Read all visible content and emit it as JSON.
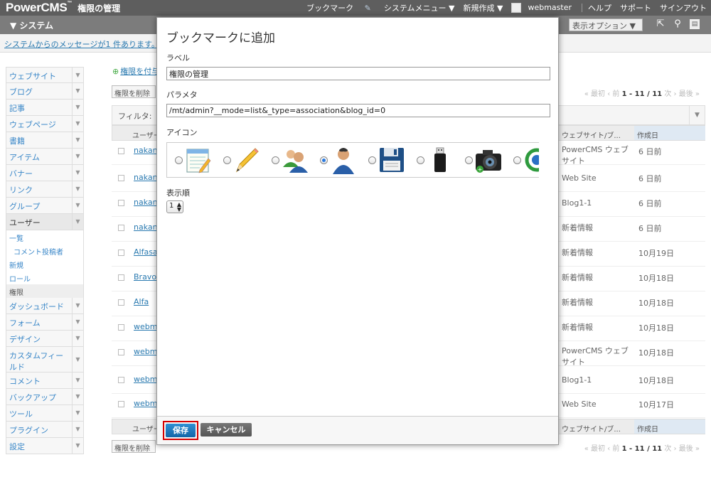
{
  "header": {
    "brand": "PowerCMS",
    "brand_mark": "™",
    "page_title": "権限の管理",
    "bookmark": "ブックマーク",
    "system_menu": "システムメニュー ▼",
    "new_item": "新規作成 ▼",
    "user": "webmaster",
    "help": "ヘルプ",
    "support": "サポート",
    "signout": "サインアウト"
  },
  "subheader": {
    "scope": "▼ システム",
    "display_options": "表示オプション ▼"
  },
  "message_bar": {
    "text": "システムからのメッセージが1 件あります。"
  },
  "sidebar": {
    "items_top": [
      "ウェブサイト",
      "ブログ",
      "記事",
      "ウェブページ",
      "書籍",
      "アイテム",
      "バナー",
      "リンク",
      "グループ"
    ],
    "open_item": "ユーザー",
    "sub_items": [
      {
        "label": "一覧",
        "indent": false
      },
      {
        "label": "コメント投稿者",
        "indent": true
      },
      {
        "label": "新規",
        "indent": false
      },
      {
        "label": "ロール",
        "indent": false
      },
      {
        "label": "権限",
        "indent": false
      }
    ],
    "items_bottom": [
      "ダッシュボード",
      "フォーム",
      "デザイン",
      "カスタムフィールド",
      "コメント",
      "バックアップ",
      "ツール",
      "プラグイン",
      "設定"
    ]
  },
  "main": {
    "grant_link": "権限を付与",
    "delete_button": "権限を削除",
    "pager": {
      "first": "« 最初",
      "prev": "‹ 前",
      "range": "1 - 11 / 11",
      "next": "次 ›",
      "last": "最後 »"
    },
    "filter_label": "フィルタ:",
    "columns": {
      "user": "ユーザー",
      "site": "ウェブサイト/ブ...",
      "created": "作成日"
    },
    "rows": [
      {
        "user": "nakan",
        "site": "PowerCMS ウェブサイト",
        "date": "6 日前"
      },
      {
        "user": "nakan",
        "site": "Web Site",
        "date": "6 日前"
      },
      {
        "user": "nakan",
        "site": "Blog1-1",
        "date": "6 日前"
      },
      {
        "user": "nakan",
        "site": "新着情報",
        "date": "6 日前"
      },
      {
        "user": "Alfasa",
        "site": "新着情報",
        "date": "10月19日"
      },
      {
        "user": "Bravo",
        "site": "新着情報",
        "date": "10月18日"
      },
      {
        "user": "Alfa",
        "site": "新着情報",
        "date": "10月18日"
      },
      {
        "user": "webm",
        "site": "新着情報",
        "date": "10月18日"
      },
      {
        "user": "webm",
        "site": "PowerCMS ウェブサイト",
        "date": "10月18日"
      },
      {
        "user": "webm",
        "site": "Blog1-1",
        "date": "10月18日"
      },
      {
        "user": "webm",
        "site": "Web Site",
        "date": "10月17日"
      }
    ]
  },
  "modal": {
    "title": "ブックマークに追加",
    "label_caption": "ラベル",
    "label_value": "権限の管理",
    "param_caption": "パラメタ",
    "param_value": "/mt/admin?__mode=list&_type=association&blog_id=0",
    "icon_caption": "アイコン",
    "icons": [
      "notepad-icon",
      "pencil-icon",
      "users-icon",
      "user-icon",
      "floppy-disk-icon",
      "usb-drive-icon",
      "camera-icon",
      "sync-icon"
    ],
    "selected_icon": "user-icon",
    "order_caption": "表示順",
    "order_value": "1",
    "save": "保存",
    "cancel": "キャンセル"
  },
  "colors": {
    "accent": "#1f78c1",
    "header": "#5e5e5e",
    "highlight_border": "#d40000"
  }
}
